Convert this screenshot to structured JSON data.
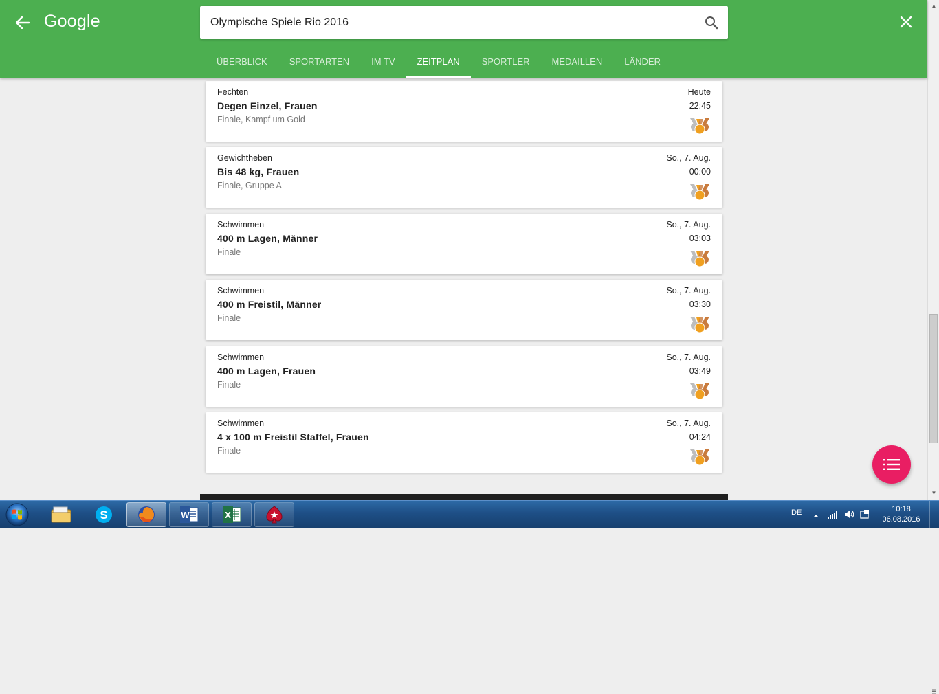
{
  "header": {
    "logo": "Google",
    "search_value": "Olympische Spiele Rio 2016",
    "tabs": [
      {
        "label": "ÜBERBLICK",
        "active": false
      },
      {
        "label": "SPORTARTEN",
        "active": false
      },
      {
        "label": "IM TV",
        "active": false
      },
      {
        "label": "ZEITPLAN",
        "active": true
      },
      {
        "label": "SPORTLER",
        "active": false
      },
      {
        "label": "MEDAILLEN",
        "active": false
      },
      {
        "label": "LÄNDER",
        "active": false
      }
    ]
  },
  "events": [
    {
      "sport": "Fechten",
      "event": "Degen Einzel, Frauen",
      "round": "Finale, Kampf um Gold",
      "date": "Heute",
      "time": "22:45",
      "icon": "medal-icon"
    },
    {
      "sport": "Gewichtheben",
      "event": "Bis 48 kg, Frauen",
      "round": "Finale, Gruppe A",
      "date": "So., 7. Aug.",
      "time": "00:00",
      "icon": "medal-icon"
    },
    {
      "sport": "Schwimmen",
      "event": "400 m Lagen, Männer",
      "round": "Finale",
      "date": "So., 7. Aug.",
      "time": "03:03",
      "icon": "medal-icon"
    },
    {
      "sport": "Schwimmen",
      "event": "400 m Freistil, Männer",
      "round": "Finale",
      "date": "So., 7. Aug.",
      "time": "03:30",
      "icon": "medal-icon"
    },
    {
      "sport": "Schwimmen",
      "event": "400 m Lagen, Frauen",
      "round": "Finale",
      "date": "So., 7. Aug.",
      "time": "03:49",
      "icon": "medal-icon"
    },
    {
      "sport": "Schwimmen",
      "event": "4 x 100 m Freistil Staffel, Frauen",
      "round": "Finale",
      "date": "So., 7. Aug.",
      "time": "04:24",
      "icon": "medal-icon"
    }
  ],
  "colors": {
    "header_green": "#4caf50",
    "fab_pink": "#e91e63",
    "gold": "#f0a020",
    "silver": "#bdbdbd",
    "bronze": "#c97b3d"
  },
  "taskbar": {
    "apps": [
      "start-orb",
      "file-explorer",
      "skype",
      "firefox",
      "word",
      "excel",
      "pokerstars"
    ],
    "language": "DE",
    "time": "10:18",
    "date": "06.08.2016"
  }
}
